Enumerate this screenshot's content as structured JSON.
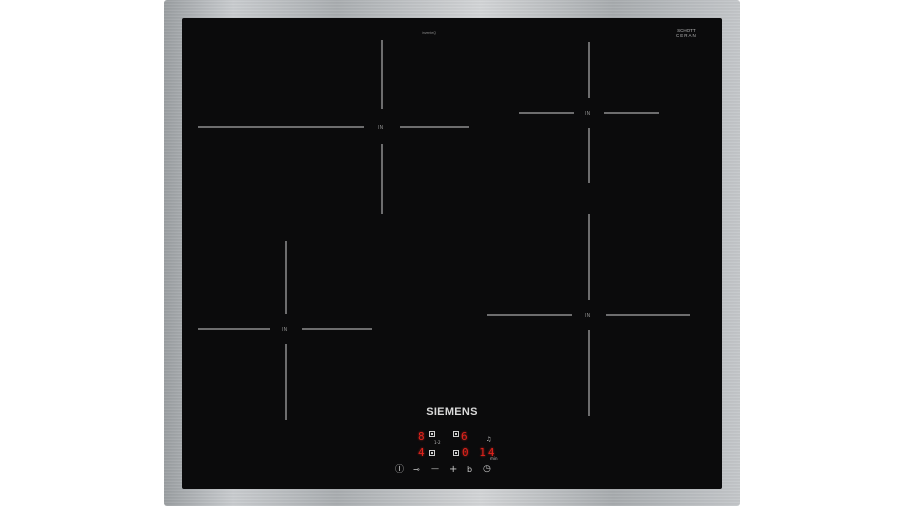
{
  "brand": "SIEMENS",
  "glass_logo": {
    "line1": "SCHOTT",
    "line2": "CERAN"
  },
  "model_text": "inventeQ",
  "zone_label": "IN",
  "display": {
    "top_left": "8",
    "top_right": "6",
    "bottom_left": "4",
    "timer": "0 14",
    "timer_unit": "min",
    "small_label": "1-2"
  },
  "controls": {
    "power": "Ⓘ",
    "key": "⊸",
    "minus": "—",
    "plus": "+",
    "boost": "b",
    "clock": "◷",
    "bell": "♫"
  },
  "colors": {
    "glass": "#0b0b0c",
    "frame": "#b8bbbe",
    "display_red": "#e0231c",
    "markings": "#d0d0d0"
  }
}
